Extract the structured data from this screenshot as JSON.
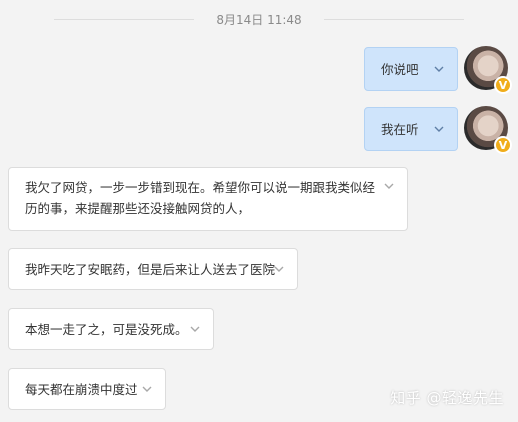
{
  "timestamp": "8月14日 11:48",
  "messages": {
    "sent": [
      {
        "text": "你说吧"
      },
      {
        "text": "我在听"
      }
    ],
    "received": [
      {
        "text": "我欠了网贷，一步一步错到现在。希望你可以说一期跟我类似经历的事，来提醒那些还没接触网贷的人，"
      },
      {
        "text": "我昨天吃了安眠药，但是后来让人送去了医院"
      },
      {
        "text": "本想一走了之，可是没死成。"
      },
      {
        "text": "每天都在崩溃中度过"
      }
    ]
  },
  "avatar_badge": "V",
  "watermark": "知乎 @轻逸先生",
  "colors": {
    "background": "#f3f3f3",
    "sent_bubble": "#cfe4fb",
    "received_bubble": "#ffffff",
    "badge": "#f0ad1c"
  },
  "icons": [
    "chevron-down-icon",
    "verified-badge-icon"
  ]
}
